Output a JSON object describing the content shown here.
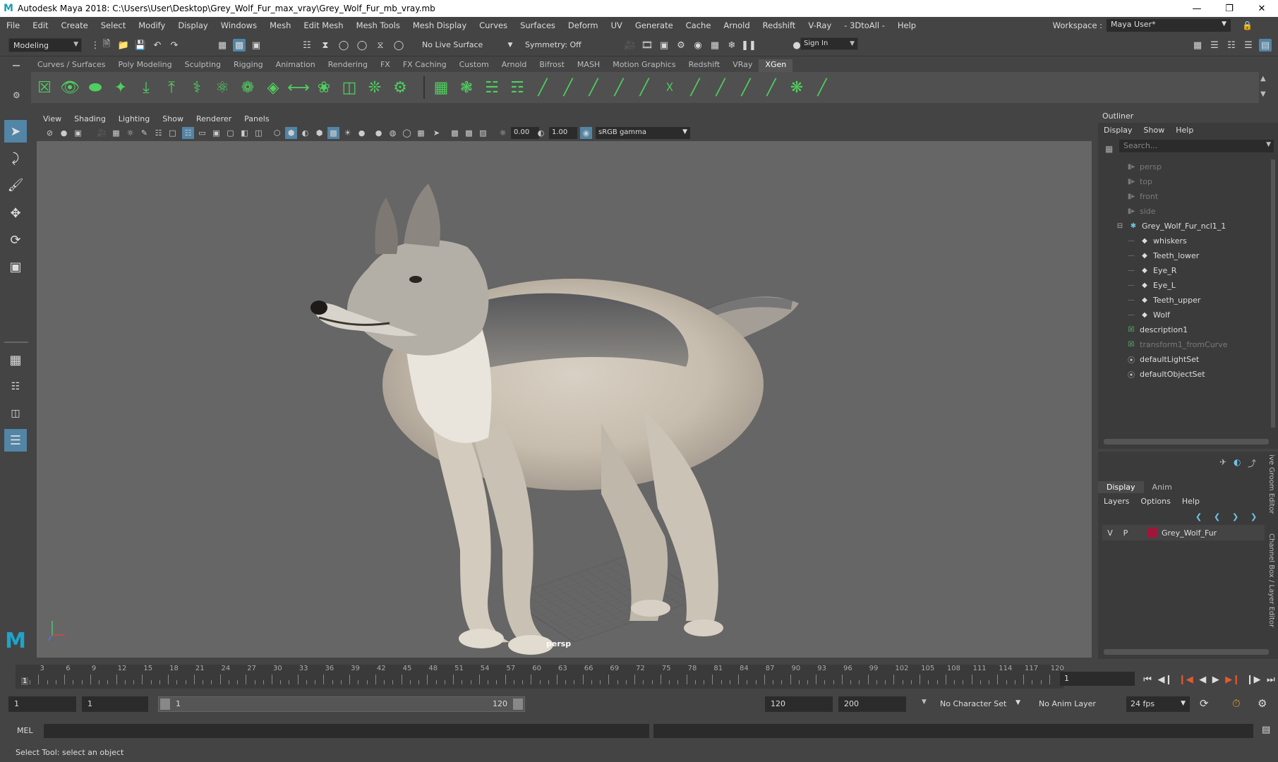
{
  "app": {
    "title": "Autodesk Maya 2018: C:\\Users\\User\\Desktop\\Grey_Wolf_Fur_max_vray\\Grey_Wolf_Fur_mb_vray.mb",
    "logo": "M"
  },
  "menus": [
    "File",
    "Edit",
    "Create",
    "Select",
    "Modify",
    "Display",
    "Windows",
    "Mesh",
    "Edit Mesh",
    "Mesh Tools",
    "Mesh Display",
    "Curves",
    "Surfaces",
    "Deform",
    "UV",
    "Generate",
    "Cache",
    "Arnold",
    "Redshift",
    "V-Ray",
    "- 3DtoAll -",
    "Help"
  ],
  "workspace": {
    "label": "Workspace :",
    "value": "Maya User*"
  },
  "status_line": {
    "mode": "Modeling",
    "live_surface": "No Live Surface",
    "symmetry": "Symmetry: Off",
    "sign_in": "Sign In"
  },
  "shelf_tabs": [
    "Curves / Surfaces",
    "Poly Modeling",
    "Sculpting",
    "Rigging",
    "Animation",
    "Rendering",
    "FX",
    "FX Caching",
    "Custom",
    "Arnold",
    "Bifrost",
    "MASH",
    "Motion Graphics",
    "Redshift",
    "VRay",
    "XGen"
  ],
  "shelf_active": "XGen",
  "viewport": {
    "menu": [
      "View",
      "Shading",
      "Lighting",
      "Show",
      "Renderer",
      "Panels"
    ],
    "exposure": "0.00",
    "gamma": "1.00",
    "color_space": "sRGB gamma",
    "camera_label": "persp"
  },
  "outliner": {
    "title": "Outliner",
    "menu": [
      "Display",
      "Show",
      "Help"
    ],
    "search_placeholder": "Search...",
    "items": [
      {
        "label": "persp",
        "icon": "camera-icon",
        "dim": true
      },
      {
        "label": "top",
        "icon": "camera-icon",
        "dim": true
      },
      {
        "label": "front",
        "icon": "camera-icon",
        "dim": true
      },
      {
        "label": "side",
        "icon": "camera-icon",
        "dim": true
      },
      {
        "label": "Grey_Wolf_Fur_ncl1_1",
        "icon": "group-icon",
        "dim": false
      },
      {
        "label": "whiskers",
        "icon": "mesh-icon",
        "dim": false
      },
      {
        "label": "Teeth_lower",
        "icon": "mesh-icon",
        "dim": false
      },
      {
        "label": "Eye_R",
        "icon": "mesh-icon",
        "dim": false
      },
      {
        "label": "Eye_L",
        "icon": "mesh-icon",
        "dim": false
      },
      {
        "label": "Teeth_upper",
        "icon": "mesh-icon",
        "dim": false
      },
      {
        "label": "Wolf",
        "icon": "mesh-icon",
        "dim": false
      },
      {
        "label": "description1",
        "icon": "xgen-icon",
        "dim": false
      },
      {
        "label": "transform1_fromCurve",
        "icon": "xgen-icon",
        "dim": true
      },
      {
        "label": "defaultLightSet",
        "icon": "set-icon",
        "dim": false
      },
      {
        "label": "defaultObjectSet",
        "icon": "set-icon",
        "dim": false
      }
    ]
  },
  "layer_editor": {
    "tabs": [
      "Display",
      "Anim"
    ],
    "menu": [
      "Layers",
      "Options",
      "Help"
    ],
    "layer": {
      "v": "V",
      "p": "P",
      "name": "Grey_Wolf_Fur",
      "color": "#a0153a"
    },
    "side_labels": [
      "ive Groom Editor",
      "Channel Box / Layer Editor"
    ]
  },
  "time_slider": {
    "labels": [
      "3",
      "6",
      "9",
      "12",
      "15",
      "18",
      "21",
      "24",
      "27",
      "30",
      "33",
      "36",
      "39",
      "42",
      "45",
      "48",
      "51",
      "54",
      "57",
      "60",
      "63",
      "66",
      "69",
      "72",
      "75",
      "78",
      "81",
      "84",
      "87",
      "90",
      "93",
      "96",
      "99",
      "102",
      "105",
      "108",
      "111",
      "114",
      "117",
      "120"
    ],
    "current_frame": "1",
    "current_field": "1"
  },
  "range": {
    "start": "1",
    "playback_start": "1",
    "range_start": "1",
    "range_end": "120",
    "playback_end": "120",
    "end": "200",
    "character_set": "No Character Set",
    "anim_layer": "No Anim Layer",
    "fps": "24 fps"
  },
  "command_line": {
    "label": "MEL"
  },
  "help_line": "Select Tool: select an object"
}
